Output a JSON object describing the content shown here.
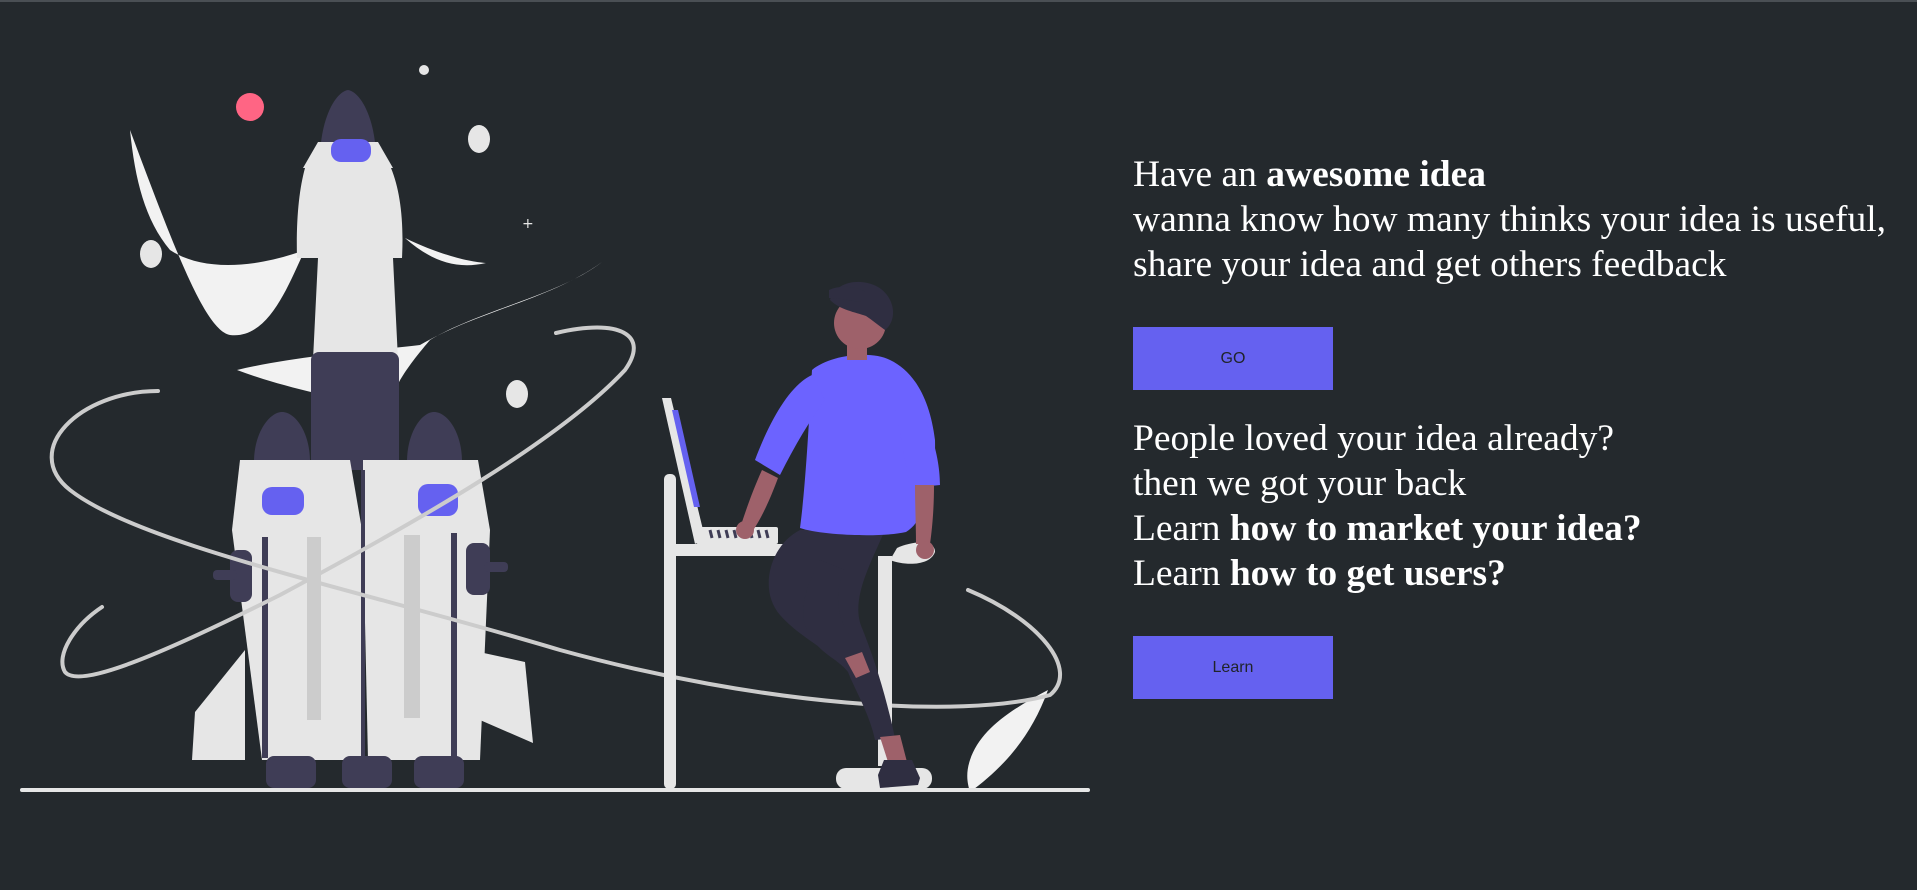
{
  "hero": {
    "line1_prefix": "Have an ",
    "line1_bold": "awesome idea",
    "line2": "wanna know how many thinks your idea is useful,",
    "line3": "share your idea and get others feedback",
    "go_button": "GO"
  },
  "second": {
    "line1": "People loved your idea already?",
    "line2": "then we got your back",
    "line3_prefix": "Learn ",
    "line3_bold": "how to market your idea?",
    "line4_prefix": "Learn ",
    "line4_bold": "how to get users?",
    "learn_button": "Learn"
  },
  "colors": {
    "background": "#24292d",
    "accent": "#6561f0",
    "rocket_body": "#e6e6e6",
    "dark_part": "#3f3d56",
    "planet_pink": "#ff6584",
    "skin": "#9e616a"
  }
}
